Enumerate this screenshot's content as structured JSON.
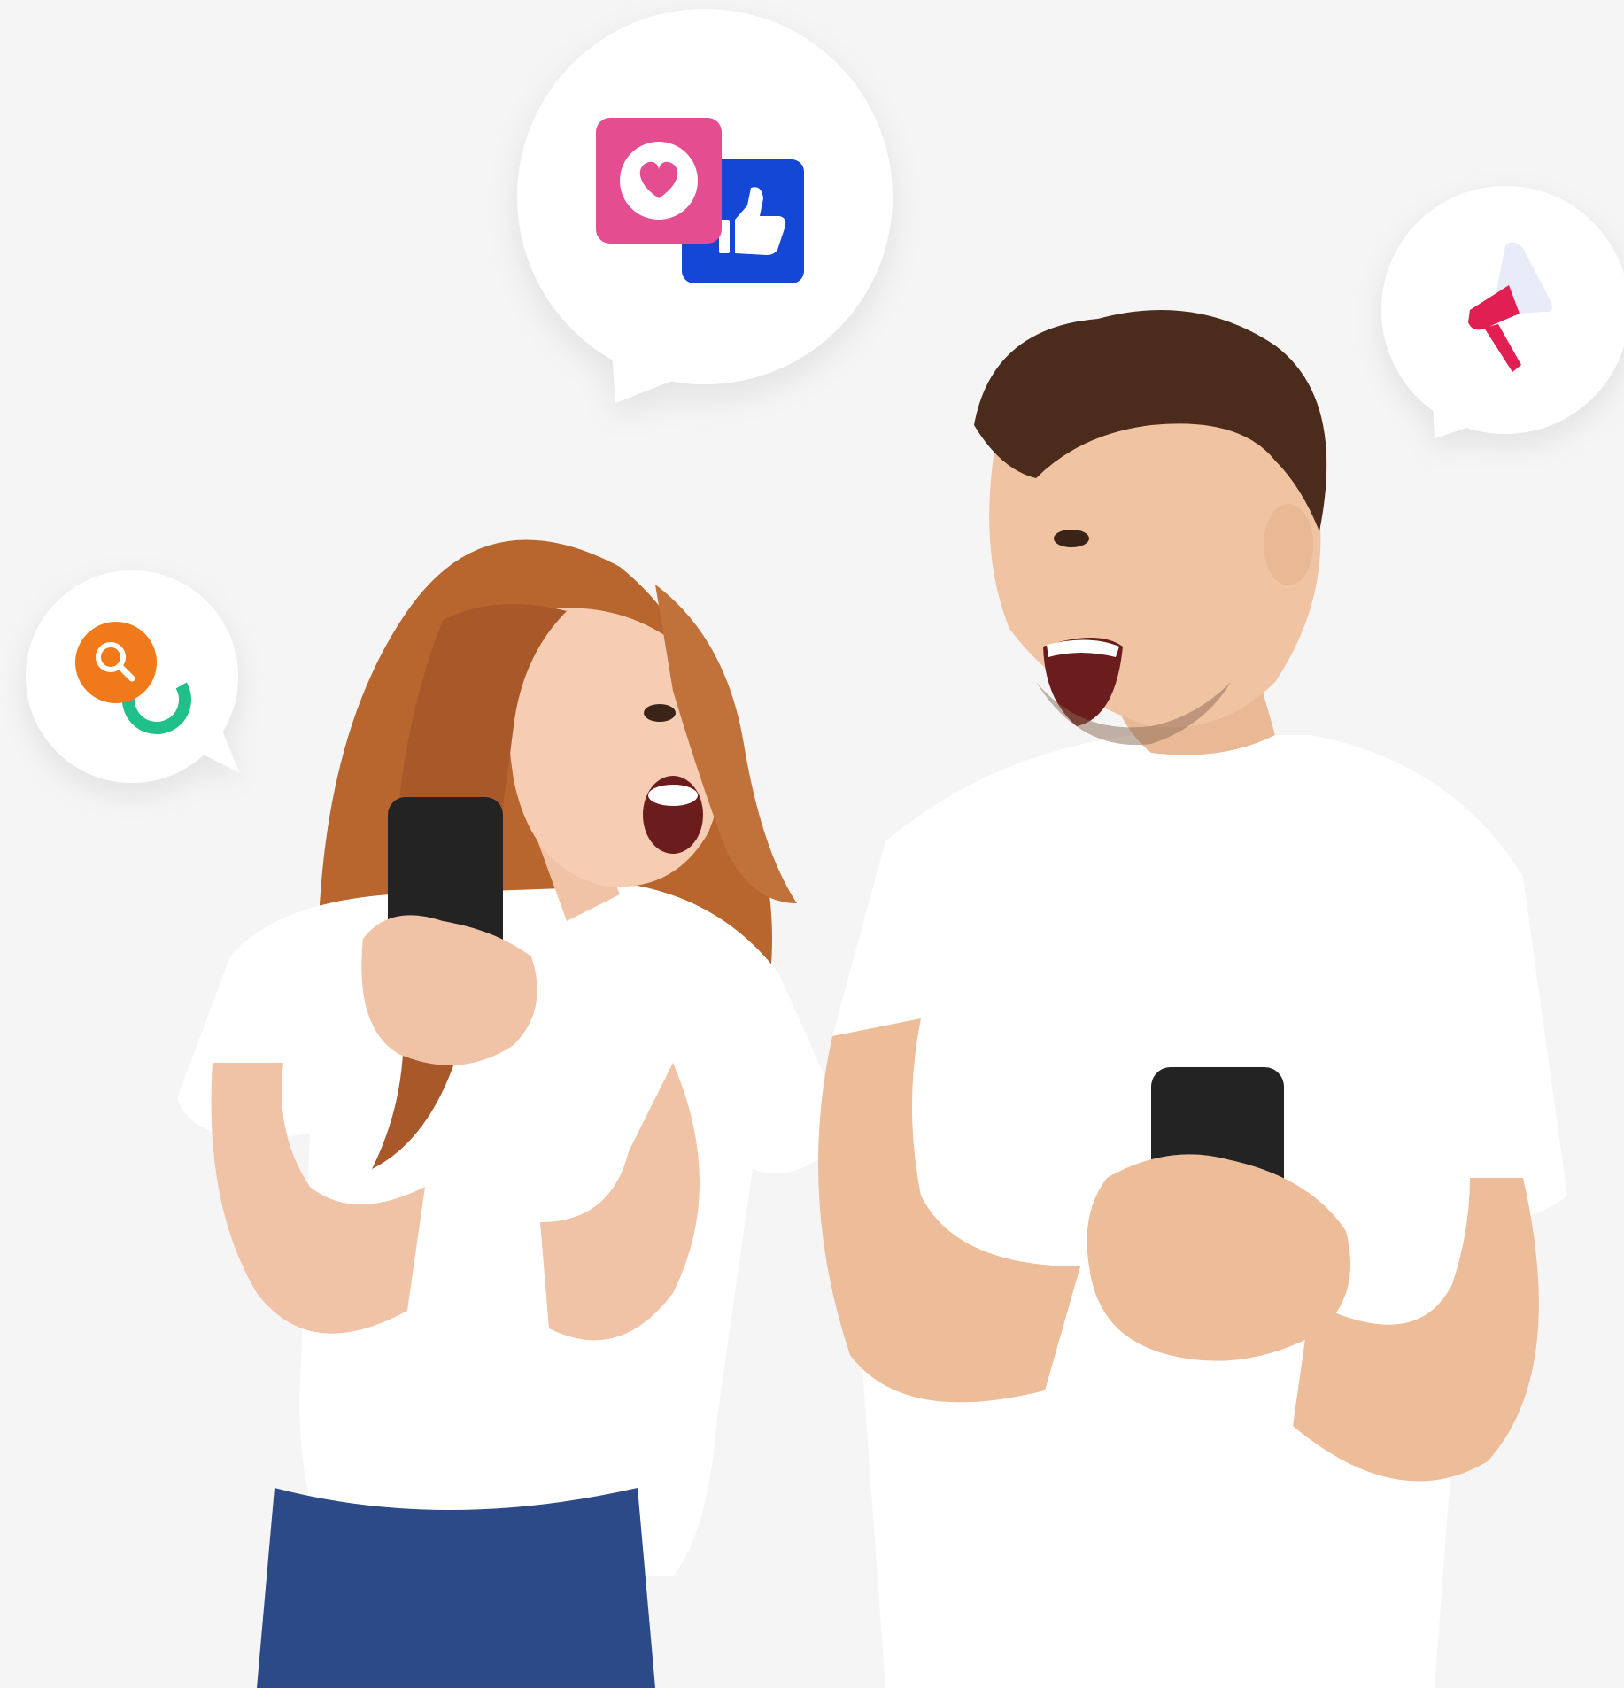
{
  "scene": {
    "background_color": "#f5f5f5",
    "bubbles": [
      {
        "name": "likes-bubble",
        "icons": [
          "heart-icon",
          "thumbs-up-icon"
        ],
        "colors": [
          "#e44d8f",
          "#1447d6"
        ]
      },
      {
        "name": "megaphone-bubble",
        "icons": [
          "megaphone-icon"
        ],
        "colors": [
          "#e21f52",
          "#e8ebf8"
        ]
      },
      {
        "name": "search-bubble",
        "icons": [
          "search-icon",
          "refresh-ring-icon"
        ],
        "colors": [
          "#f07a1a",
          "#1fc08a"
        ]
      }
    ],
    "people": [
      {
        "name": "woman-with-phone",
        "shirt_color": "#ffffff",
        "hair_color": "#b8652e"
      },
      {
        "name": "man-with-phone",
        "shirt_color": "#ffffff",
        "hair_color": "#4a2b1c"
      }
    ]
  }
}
